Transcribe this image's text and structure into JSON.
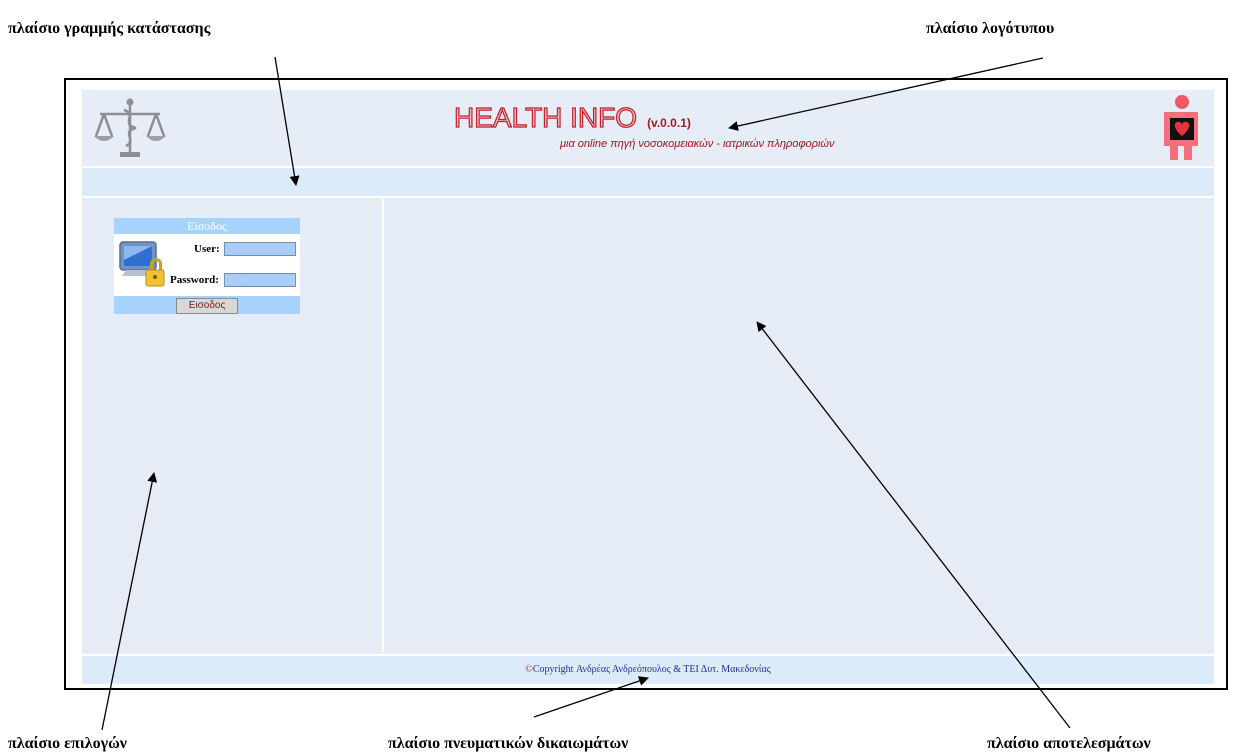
{
  "annotations": {
    "status_frame": "πλαίσιο γραμμής κατάστασης",
    "logo_frame": "πλαίσιο λογότυπου",
    "options_frame": "πλαίσιο επιλογών",
    "copyright_frame": "πλαίσιο πνευματικών δικαιωμάτων",
    "results_frame": "πλαίσιο αποτελεσμάτων"
  },
  "header": {
    "title": "HEALTH INFO",
    "version": "(v.0.0.1)",
    "tagline": "μια online πηγή νοσοκομειακών - ιατρικών πληροφοριών",
    "left_logo_icon": "scales-of-justice-icon",
    "right_logo_icon": "human-heart-icon"
  },
  "login": {
    "title": "Είσοδος",
    "user_label": "User:",
    "password_label": "Password:",
    "user_value": "",
    "password_value": "",
    "submit_label": "Εισοδος",
    "icon": "computer-lock-icon"
  },
  "footer": {
    "copyright_symbol": "©",
    "text": "Copyright Ανδρέας Ανδρεόπουλος & ΤΕΙ Δυτ. Μακεδονίας"
  },
  "colors": {
    "page_bg": "#e6ecf5",
    "bar_bg": "#dcebfa",
    "login_accent": "#a7d2fb",
    "brand_red": "#c0202a"
  }
}
